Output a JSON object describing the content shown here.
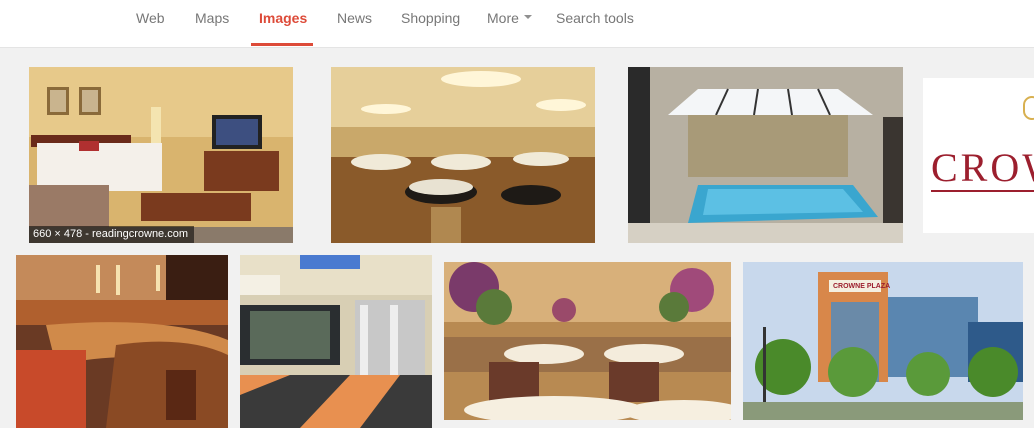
{
  "nav": {
    "tabs": [
      {
        "label": "Web",
        "active": false
      },
      {
        "label": "Maps",
        "active": false
      },
      {
        "label": "Images",
        "active": true
      },
      {
        "label": "News",
        "active": false
      },
      {
        "label": "Shopping",
        "active": false
      },
      {
        "label": "More",
        "active": false,
        "has_dropdown": true
      },
      {
        "label": "Search tools",
        "active": false
      }
    ],
    "active_color": "#dd4b39"
  },
  "results": [
    {
      "subject": "hotel guest room",
      "caption": "660 × 478 - readingcrowne.com"
    },
    {
      "subject": "banquet ballroom"
    },
    {
      "subject": "indoor pool"
    },
    {
      "subject": "hotel logo",
      "logo_text": "CROW"
    },
    {
      "subject": "hotel bar"
    },
    {
      "subject": "fitness center"
    },
    {
      "subject": "banquet with floral centerpieces"
    },
    {
      "subject": "hotel exterior",
      "sign_text": "CROWNE PLAZA"
    }
  ]
}
